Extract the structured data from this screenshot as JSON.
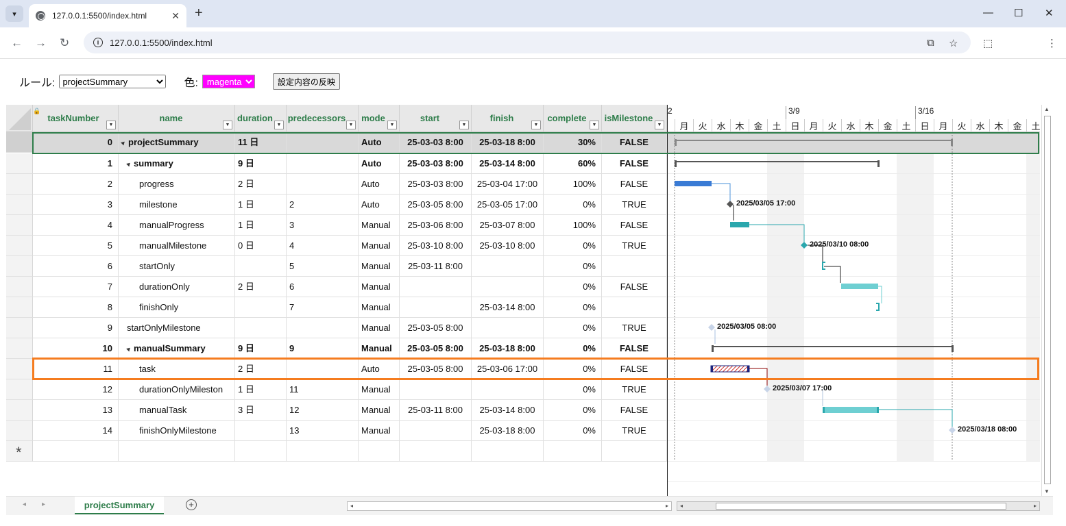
{
  "browser": {
    "tab_title": "127.0.0.1:5500/index.html",
    "url": "127.0.0.1:5500/index.html"
  },
  "settings": {
    "rule_label": "ルール:",
    "rule_value": "projectSummary",
    "color_label": "色:",
    "color_value": "magenta",
    "color_hex": "#ff00ff",
    "apply_label": "設定内容の反映"
  },
  "columns": [
    {
      "key": "taskNumber",
      "label": "taskNumber"
    },
    {
      "key": "name",
      "label": "name"
    },
    {
      "key": "duration",
      "label": "duration"
    },
    {
      "key": "predecessors",
      "label": "predecessors"
    },
    {
      "key": "mode",
      "label": "mode"
    },
    {
      "key": "start",
      "label": "start"
    },
    {
      "key": "finish",
      "label": "finish"
    },
    {
      "key": "complete",
      "label": "complete"
    },
    {
      "key": "isMilestone",
      "label": "isMilestone"
    }
  ],
  "rows": [
    {
      "taskNumber": "0",
      "name": "projectSummary",
      "duration": "11 日",
      "predecessors": "",
      "mode": "Auto",
      "start": "25-03-03 8:00",
      "finish": "25-03-18 8:00",
      "complete": "30%",
      "isMilestone": "FALSE",
      "level": 0,
      "summary": true
    },
    {
      "taskNumber": "1",
      "name": "summary",
      "duration": "9 日",
      "predecessors": "",
      "mode": "Auto",
      "start": "25-03-03 8:00",
      "finish": "25-03-14 8:00",
      "complete": "60%",
      "isMilestone": "FALSE",
      "level": 1,
      "summary": true
    },
    {
      "taskNumber": "2",
      "name": "progress",
      "duration": "2 日",
      "predecessors": "",
      "mode": "Auto",
      "start": "25-03-03 8:00",
      "finish": "25-03-04 17:00",
      "complete": "100%",
      "isMilestone": "FALSE",
      "level": 2,
      "summary": false
    },
    {
      "taskNumber": "3",
      "name": "milestone",
      "duration": "1 日",
      "predecessors": "2",
      "mode": "Auto",
      "start": "25-03-05 8:00",
      "finish": "25-03-05 17:00",
      "complete": "0%",
      "isMilestone": "TRUE",
      "level": 2,
      "summary": false
    },
    {
      "taskNumber": "4",
      "name": "manualProgress",
      "duration": "1 日",
      "predecessors": "3",
      "mode": "Manual",
      "start": "25-03-06 8:00",
      "finish": "25-03-07 8:00",
      "complete": "100%",
      "isMilestone": "FALSE",
      "level": 2,
      "summary": false
    },
    {
      "taskNumber": "5",
      "name": "manualMilestone",
      "duration": "0 日",
      "predecessors": "4",
      "mode": "Manual",
      "start": "25-03-10 8:00",
      "finish": "25-03-10 8:00",
      "complete": "0%",
      "isMilestone": "TRUE",
      "level": 2,
      "summary": false
    },
    {
      "taskNumber": "6",
      "name": "startOnly",
      "duration": "",
      "predecessors": "5",
      "mode": "Manual",
      "start": "25-03-11 8:00",
      "finish": "",
      "complete": "0%",
      "isMilestone": "",
      "level": 2,
      "summary": false
    },
    {
      "taskNumber": "7",
      "name": "durationOnly",
      "duration": "2 日",
      "predecessors": "6",
      "mode": "Manual",
      "start": "",
      "finish": "",
      "complete": "0%",
      "isMilestone": "FALSE",
      "level": 2,
      "summary": false
    },
    {
      "taskNumber": "8",
      "name": "finishOnly",
      "duration": "",
      "predecessors": "7",
      "mode": "Manual",
      "start": "",
      "finish": "25-03-14 8:00",
      "complete": "0%",
      "isMilestone": "",
      "level": 2,
      "summary": false
    },
    {
      "taskNumber": "9",
      "name": "startOnlyMilestone",
      "duration": "",
      "predecessors": "",
      "mode": "Manual",
      "start": "25-03-05 8:00",
      "finish": "",
      "complete": "0%",
      "isMilestone": "TRUE",
      "level": 1,
      "summary": false
    },
    {
      "taskNumber": "10",
      "name": "manualSummary",
      "duration": "9 日",
      "predecessors": "9",
      "mode": "Manual",
      "start": "25-03-05 8:00",
      "finish": "25-03-18 8:00",
      "complete": "0%",
      "isMilestone": "FALSE",
      "level": 1,
      "summary": true
    },
    {
      "taskNumber": "11",
      "name": "task",
      "duration": "2 日",
      "predecessors": "",
      "mode": "Auto",
      "start": "25-03-05 8:00",
      "finish": "25-03-06 17:00",
      "complete": "0%",
      "isMilestone": "FALSE",
      "level": 2,
      "summary": false
    },
    {
      "taskNumber": "12",
      "name": "durationOnlyMileston",
      "duration": "1 日",
      "predecessors": "11",
      "mode": "Manual",
      "start": "",
      "finish": "",
      "complete": "0%",
      "isMilestone": "TRUE",
      "level": 2,
      "summary": false
    },
    {
      "taskNumber": "13",
      "name": "manualTask",
      "duration": "3 日",
      "predecessors": "12",
      "mode": "Manual",
      "start": "25-03-11 8:00",
      "finish": "25-03-14 8:00",
      "complete": "0%",
      "isMilestone": "FALSE",
      "level": 2,
      "summary": false
    },
    {
      "taskNumber": "14",
      "name": "finishOnlyMilestone",
      "duration": "",
      "predecessors": "13",
      "mode": "Manual",
      "start": "",
      "finish": "25-03-18 8:00",
      "complete": "0%",
      "isMilestone": "TRUE",
      "level": 2,
      "summary": false
    }
  ],
  "new_row_marker": "*",
  "gantt": {
    "week_labels": [
      "2",
      "3/9",
      "3/16"
    ],
    "day_labels": [
      "月",
      "火",
      "水",
      "木",
      "金",
      "土",
      "日",
      "月",
      "火",
      "水",
      "木",
      "金",
      "土",
      "日",
      "月",
      "火",
      "水",
      "木",
      "金",
      "土"
    ],
    "milestone_labels": [
      "2025/03/05 17:00",
      "2025/03/10 08:00",
      "2025/03/05 08:00",
      "2025/03/07 17:00",
      "2025/03/18 08:00"
    ]
  },
  "sheet": {
    "tab_label": "projectSummary"
  },
  "colors": {
    "header_text": "#2e7d4a",
    "highlight_orange": "#f57c1f",
    "progress_blue": "#3a7bd5",
    "teal": "#2aa7ad",
    "teal_light": "#6ecfd2"
  }
}
